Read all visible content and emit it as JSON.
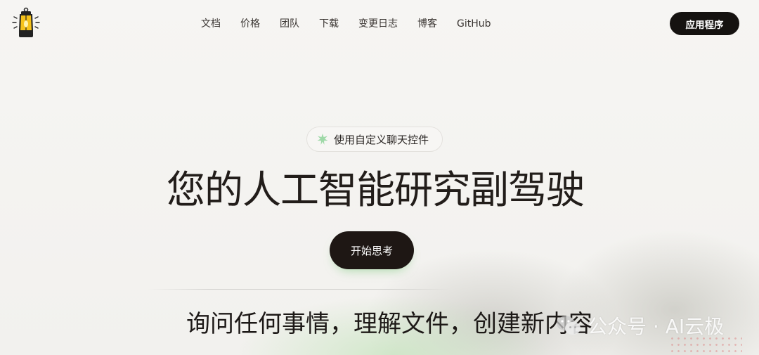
{
  "header": {
    "logo_icon": "lantern-logo-icon",
    "nav": [
      {
        "label": "文档"
      },
      {
        "label": "价格"
      },
      {
        "label": "团队"
      },
      {
        "label": "下载"
      },
      {
        "label": "变更日志"
      },
      {
        "label": "博客"
      },
      {
        "label": "GitHub"
      }
    ],
    "app_button": "应用程序"
  },
  "hero": {
    "badge_icon": "sparkle-icon",
    "badge_text": "使用自定义聊天控件",
    "title": "您的人工智能研究副驾驶",
    "cta": "开始思考",
    "subtitle": "询问任何事情，理解文件，创建新内容"
  },
  "watermark": {
    "icon": "wechat-icon",
    "text": "公众号 · AI云极"
  },
  "colors": {
    "background": "#f4f3f1",
    "button_dark": "#151210",
    "accent_green": "#9fd9a8"
  }
}
